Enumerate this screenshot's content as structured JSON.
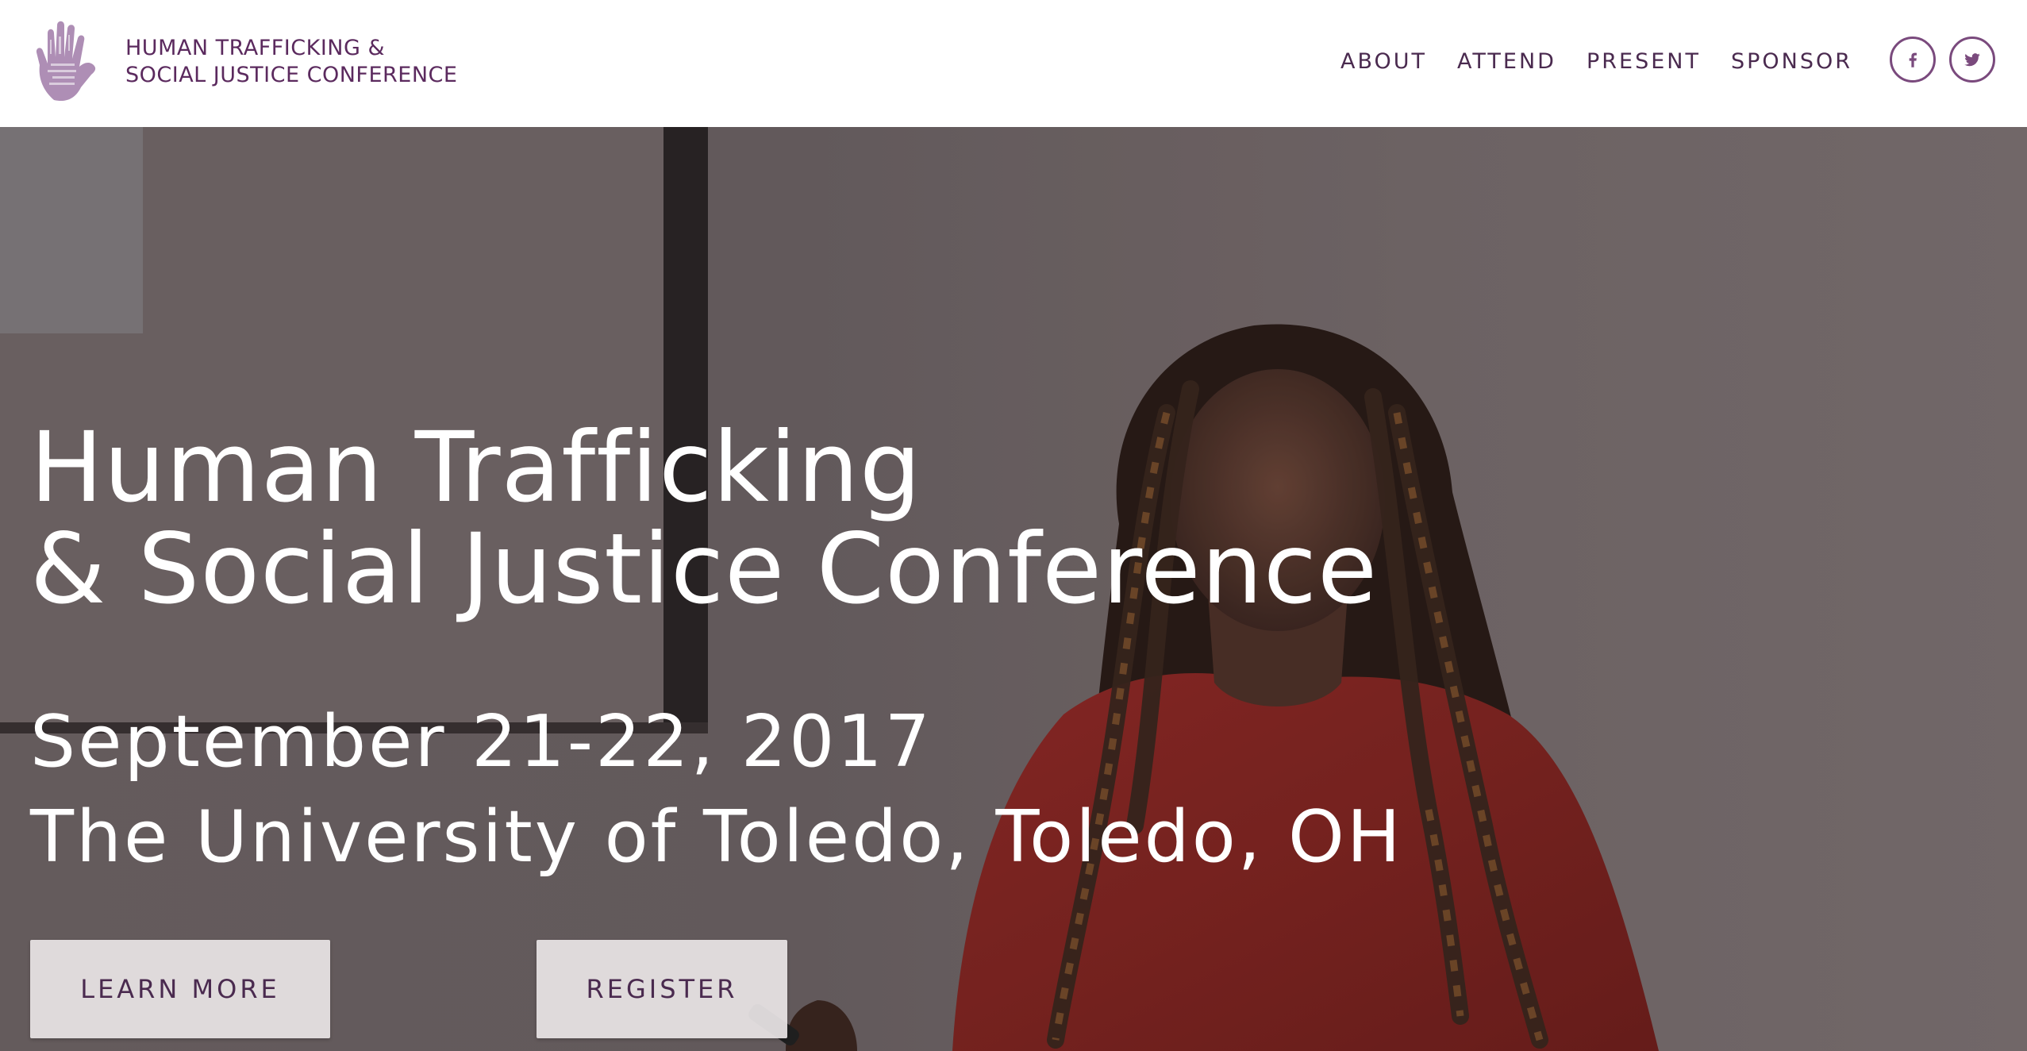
{
  "header": {
    "logo_line1": "HUMAN TRAFFICKING &",
    "logo_line2": "SOCIAL JUSTICE CONFERENCE",
    "nav": [
      {
        "label": "ABOUT"
      },
      {
        "label": "ATTEND"
      },
      {
        "label": "PRESENT"
      },
      {
        "label": "SPONSOR"
      }
    ],
    "social": [
      {
        "icon": "facebook-icon"
      },
      {
        "icon": "twitter-icon"
      }
    ]
  },
  "hero": {
    "title_line1": "Human Trafficking",
    "title_line2": "& Social Justice Conference",
    "date": "September 21-22, 2017",
    "venue": "The University of Toledo, Toledo, OH",
    "buttons": {
      "learn_more": "LEARN MORE",
      "register": "REGISTER"
    }
  },
  "colors": {
    "brand_purple": "#5b2a5e",
    "nav_text": "#4a2a4f",
    "button_bg": "#e8e4e5",
    "hero_text": "#ffffff"
  }
}
